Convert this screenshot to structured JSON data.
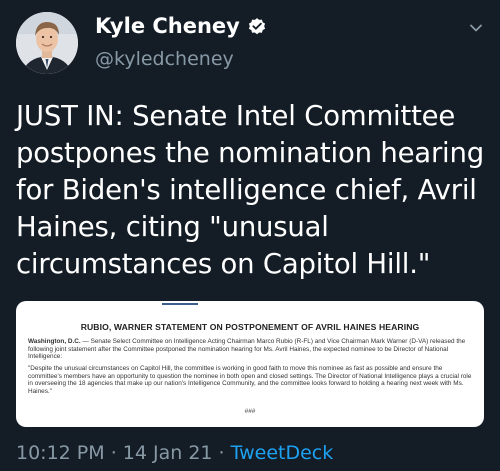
{
  "author": {
    "display_name": "Kyle Cheney",
    "handle": "@kyledcheney",
    "verified_icon": "verified-badge-icon"
  },
  "tweet": {
    "text": "JUST IN: Senate Intel Committee postpones the nomination hearing for Biden's intelligence chief, Avril Haines, citing \"unusual circumstances on Capitol Hill.\""
  },
  "attached_image": {
    "title": "RUBIO, WARNER STATEMENT ON POSTPONEMENT OF AVRIL HAINES HEARING",
    "dateline": "Washington, D.C.",
    "paragraph1_body": " — Senate Select Committee on Intelligence Acting Chairman Marco Rubio (R-FL) and Vice Chairman Mark Warner (D-VA) released the following joint statement after the Committee postponed the nomination hearing for Ms. Avril Haines, the expected nominee to be Director of National Intelligence:",
    "paragraph2": "\"Despite the unusual circumstances on Capitol Hill, the committee is working in good faith to move this nominee as fast as possible and ensure the committee's members have an opportunity to question the nominee in both open and closed settings. The Director of National Intelligence plays a crucial role in overseeing the 18 agencies that make up our nation's Intelligence Community, and the committee looks forward to holding a hearing next week with Ms. Haines.\"",
    "end_mark": "###"
  },
  "meta": {
    "time": "10:12 PM",
    "separator": " · ",
    "date": "14 Jan 21",
    "source": "TweetDeck"
  },
  "colors": {
    "background": "#141d26",
    "secondary_text": "#8899a6",
    "link": "#1da1f2"
  }
}
